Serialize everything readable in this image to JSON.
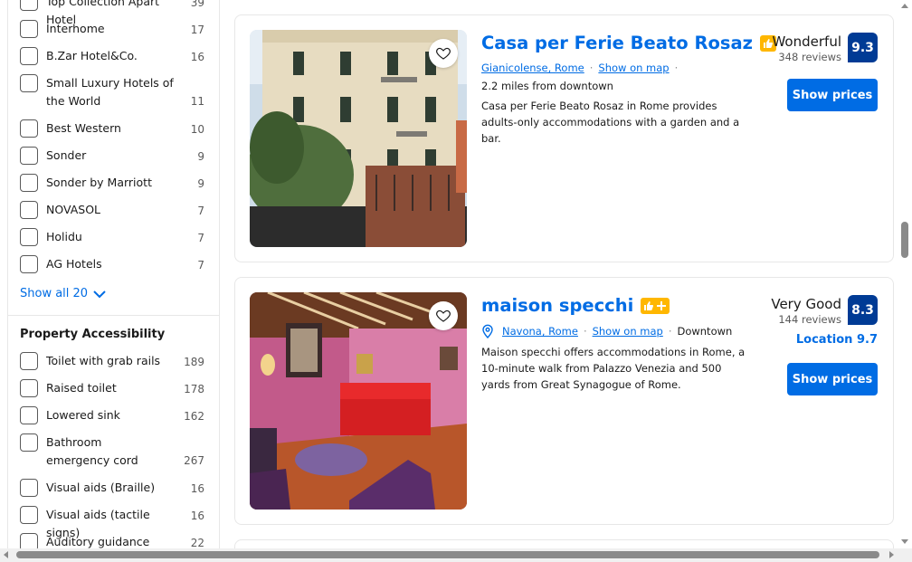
{
  "colors": {
    "link_blue": "#006ce4",
    "score_navy": "#003b95",
    "genius_yellow": "#ffb700",
    "border": "#e7e7e7"
  },
  "sidebar": {
    "chains": [
      {
        "label": "Top Collection Apart Hotel",
        "count": "39"
      },
      {
        "label": "Interhome",
        "count": "17"
      },
      {
        "label": "B.Zar Hotel&Co.",
        "count": "16"
      },
      {
        "label": "Small Luxury Hotels of the World",
        "count": "11"
      },
      {
        "label": "Best Western",
        "count": "10"
      },
      {
        "label": "Sonder",
        "count": "9"
      },
      {
        "label": "Sonder by Marriott",
        "count": "9"
      },
      {
        "label": "NOVASOL",
        "count": "7"
      },
      {
        "label": "Holidu",
        "count": "7"
      },
      {
        "label": "AG Hotels",
        "count": "7"
      }
    ],
    "show_all_label": "Show all 20",
    "accessibility_title": "Property Accessibility",
    "accessibility": [
      {
        "label": "Toilet with grab rails",
        "count": "189"
      },
      {
        "label": "Raised toilet",
        "count": "178"
      },
      {
        "label": "Lowered sink",
        "count": "162"
      },
      {
        "label": "Bathroom emergency cord",
        "count": "267"
      },
      {
        "label": "Visual aids (Braille)",
        "count": "16"
      },
      {
        "label": "Visual aids (tactile signs)",
        "count": "16"
      },
      {
        "label": "Auditory guidance",
        "count": "22"
      }
    ]
  },
  "properties": [
    {
      "name": "Casa per Ferie Beato Rosaz",
      "badge_icon": "thumbs-up-icon",
      "area": "Gianicolense, Rome",
      "map_link": "Show on map",
      "distance": "2.2 miles from downtown",
      "description": "Casa per Ferie Beato Rosaz in Rome provides adults-only accommodations with a garden and a bar.",
      "score_word": "Wonderful",
      "reviews": "348 reviews",
      "score": "9.3",
      "button": "Show prices"
    },
    {
      "name": "maison specchi",
      "badge_icon": "thumbs-up-plus-icon",
      "area": "Navona, Rome",
      "map_link": "Show on map",
      "downtown": "Downtown",
      "description": "Maison specchi offers accommodations in Rome, a 10-minute walk from Palazzo Venezia and 500 yards from Great Synagogue of Rome.",
      "score_word": "Very Good",
      "reviews": "144 reviews",
      "score": "8.3",
      "location_score": "Location 9.7",
      "button": "Show prices"
    }
  ]
}
